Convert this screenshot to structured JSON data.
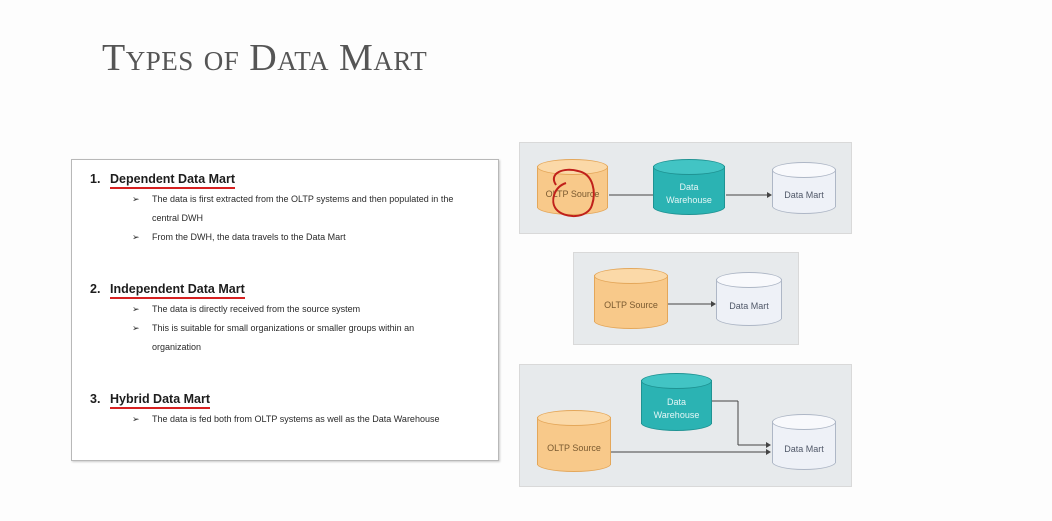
{
  "slide": {
    "title": "Types of Data Mart"
  },
  "types": [
    {
      "number": "1.",
      "name": "Dependent Data Mart",
      "bullets": [
        "The data is first extracted from the OLTP systems and then populated in the central DWH",
        "From the DWH, the data travels to the Data Mart"
      ]
    },
    {
      "number": "2.",
      "name": "Independent Data Mart",
      "bullets": [
        "The data is directly received from the source system",
        "This is suitable for small organizations or smaller groups within an organization"
      ]
    },
    {
      "number": "3.",
      "name": "Hybrid Data Mart",
      "bullets": [
        "The data is fed both from OLTP systems as well as the Data Warehouse"
      ]
    }
  ],
  "bullet_glyph": "➢",
  "diagrams": {
    "dependent": {
      "source": "OLTP Source",
      "warehouse": "Data Warehouse",
      "mart": "Data Mart"
    },
    "independent": {
      "source": "OLTP Source",
      "mart": "Data Mart"
    },
    "hybrid": {
      "warehouse": "Data Warehouse",
      "source": "OLTP Source",
      "mart": "Data Mart"
    }
  },
  "colors": {
    "underline": "#d62020",
    "oltp": "#f8c98a",
    "warehouse": "#2bb3b3",
    "mart": "#eef1f7",
    "diagram_background": "#e7eaec",
    "annotation": "#c0201a"
  }
}
